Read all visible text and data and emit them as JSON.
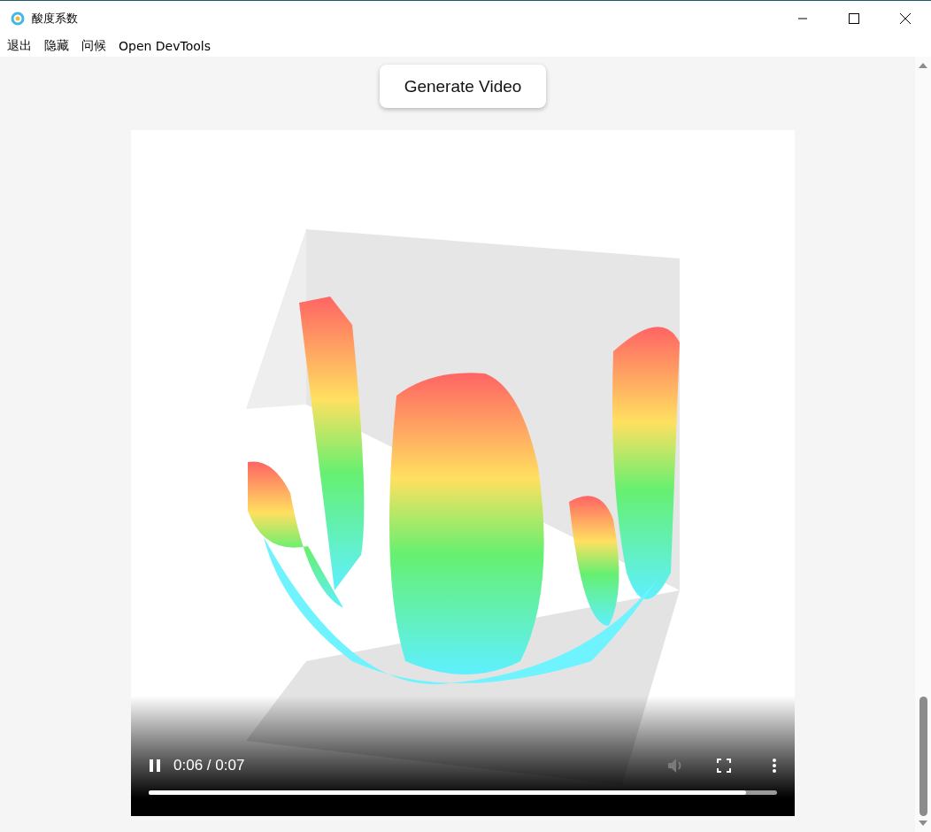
{
  "window": {
    "title": "酸度系数"
  },
  "menu": [
    {
      "label": "退出"
    },
    {
      "label": "隐藏"
    },
    {
      "label": "问候"
    },
    {
      "label": "Open DevTools"
    }
  ],
  "generate_button": {
    "label": "Generate Video"
  },
  "video": {
    "playing": true,
    "time": "0:06 / 0:07",
    "level": 0.95,
    "volume_disabled": true
  }
}
